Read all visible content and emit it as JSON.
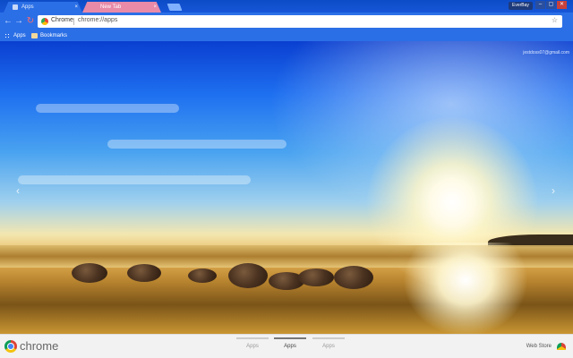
{
  "tabs": [
    {
      "label": "Apps",
      "close": "×"
    },
    {
      "label": "New Tab",
      "close": "×"
    }
  ],
  "window": {
    "user": "EverBay",
    "min": "–",
    "max": "▢",
    "close": "✕"
  },
  "toolbar": {
    "back": "←",
    "forward": "→",
    "reload": "↻",
    "brand": "Chrome",
    "url": "chrome://apps",
    "star": "☆"
  },
  "bookmarks": {
    "apps": "Apps",
    "folder": "Bookmarks"
  },
  "account_email": "jestdoss07@gmail.com",
  "nav": {
    "prev": "‹",
    "next": "›"
  },
  "footer": {
    "logo_text": "chrome",
    "pages": [
      "Apps",
      "Apps",
      "Apps"
    ],
    "active_page": 1,
    "webstore": "Web Store"
  }
}
